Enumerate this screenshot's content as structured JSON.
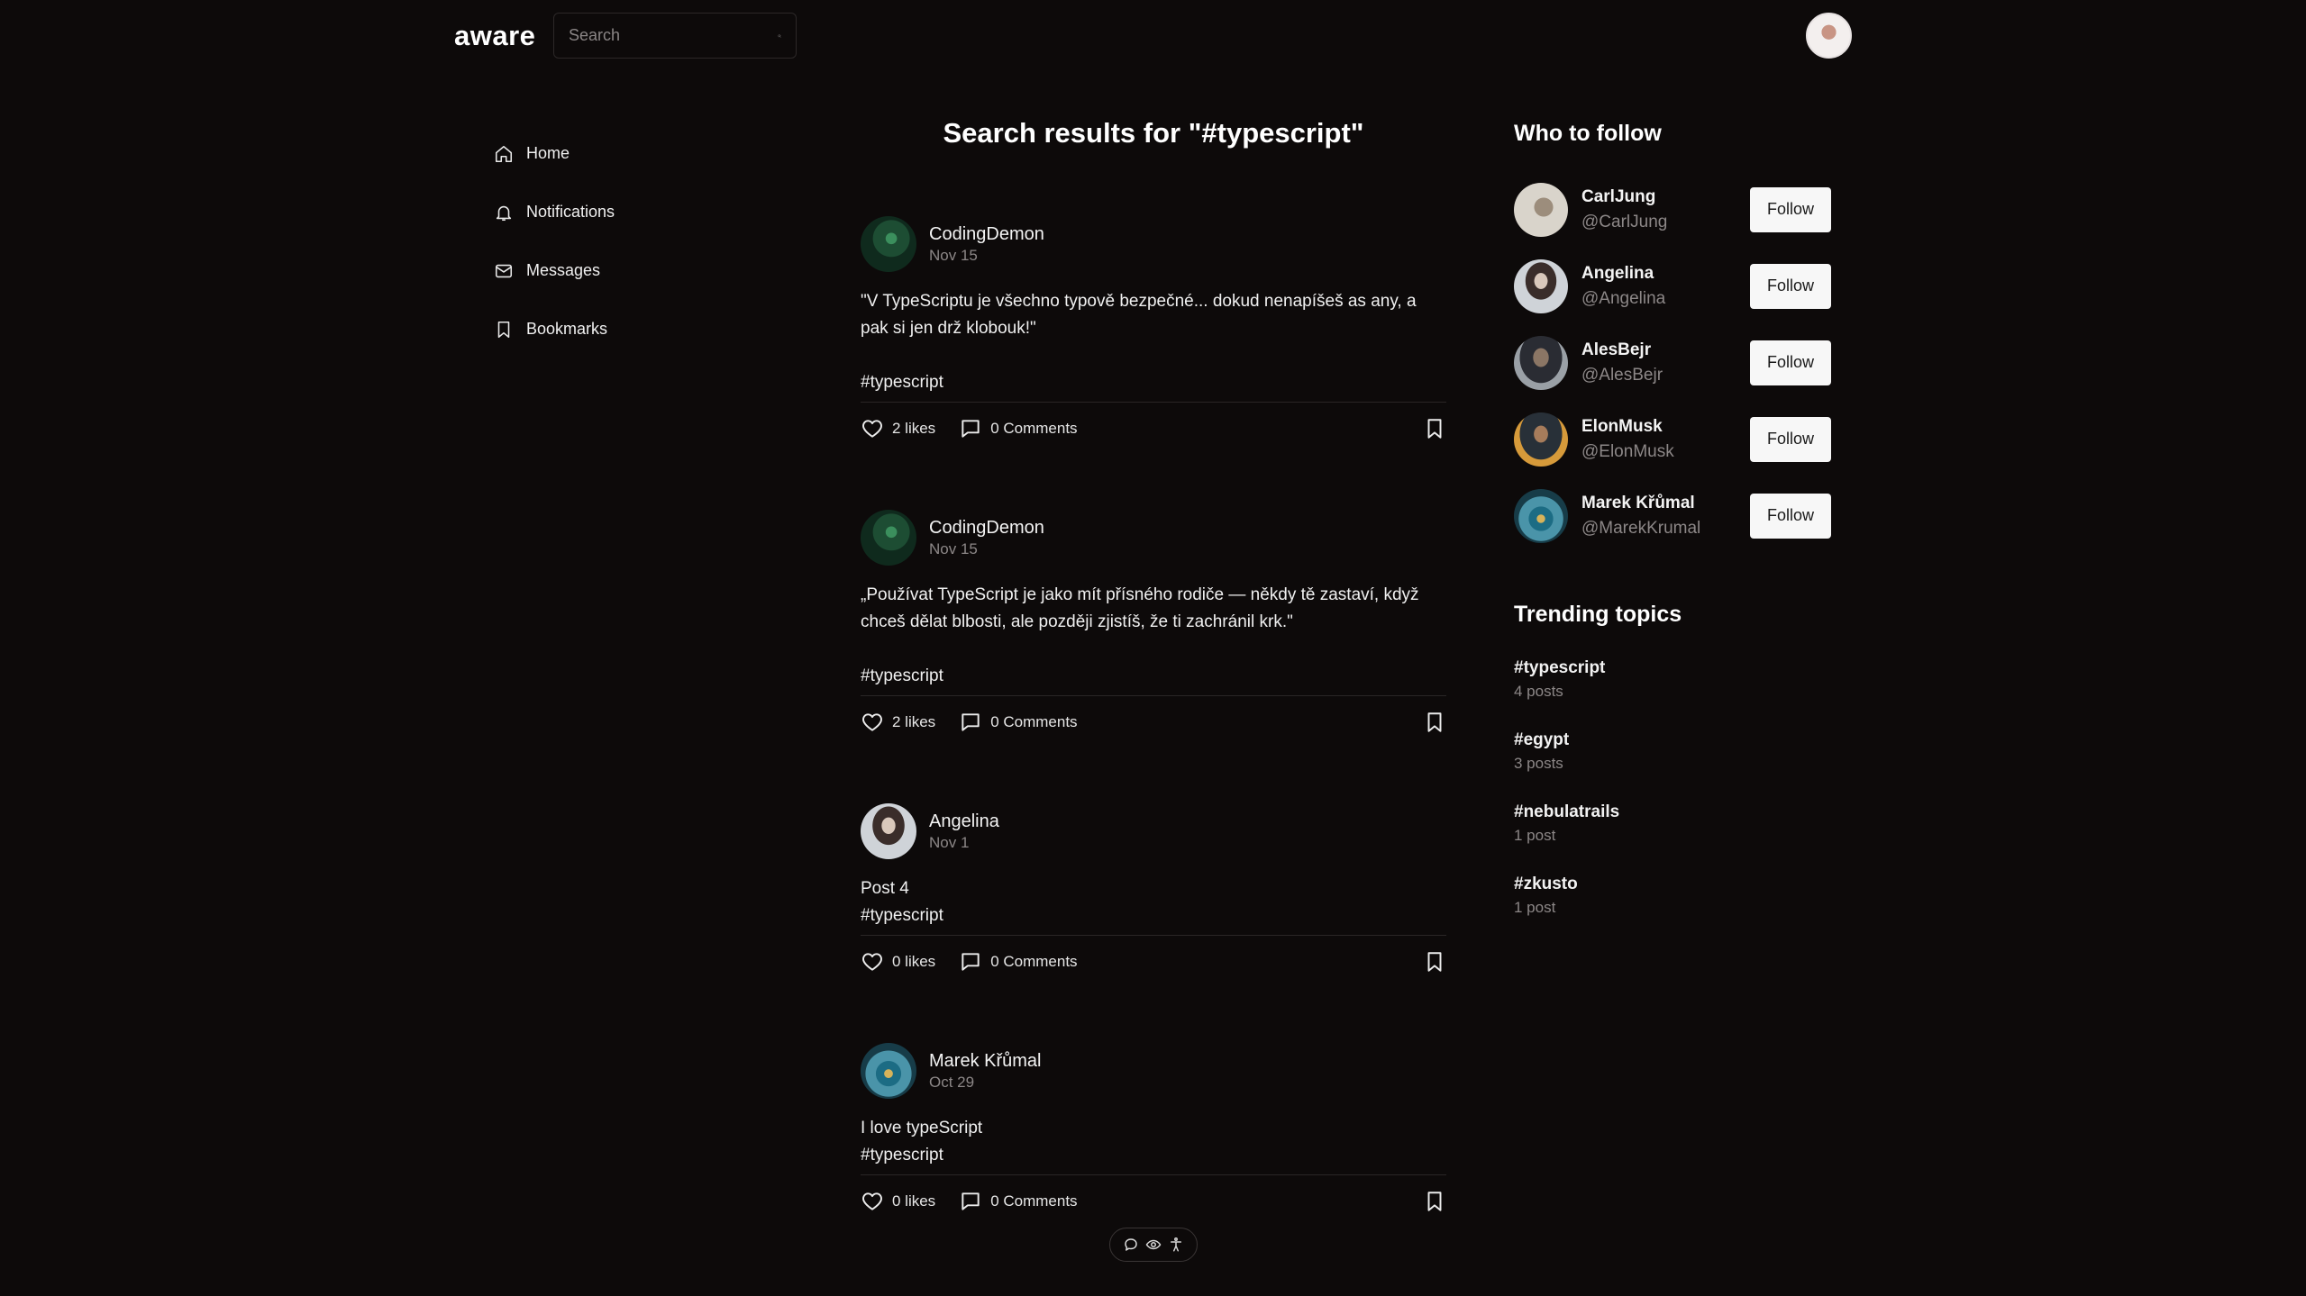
{
  "header": {
    "logo": "aware",
    "search_placeholder": "Search"
  },
  "nav": {
    "items": [
      {
        "label": "Home",
        "icon": "home-icon"
      },
      {
        "label": "Notifications",
        "icon": "bell-icon"
      },
      {
        "label": "Messages",
        "icon": "mail-icon"
      },
      {
        "label": "Bookmarks",
        "icon": "bookmark-icon"
      }
    ]
  },
  "main": {
    "title": "Search results for \"#typescript\"",
    "posts": [
      {
        "author": "CodingDemon",
        "date": "Nov 15",
        "text": "\"V TypeScriptu je všechno typově bezpečné... dokud nenapíšeš as any, a pak si jen drž klobouk!\"",
        "tag": "#typescript",
        "likes": "2 likes",
        "comments": "0 Comments"
      },
      {
        "author": "CodingDemon",
        "date": "Nov 15",
        "text": "„Používat TypeScript je jako mít přísného rodiče — někdy tě zastaví, když chceš dělat blbosti, ale později zjistíš, že ti zachránil krk.\"",
        "tag": "#typescript",
        "likes": "2 likes",
        "comments": "0 Comments"
      },
      {
        "author": "Angelina",
        "date": "Nov 1",
        "text": "Post 4",
        "tag": "#typescript",
        "likes": "0 likes",
        "comments": "0 Comments"
      },
      {
        "author": "Marek Křůmal",
        "date": "Oct 29",
        "text": "I love typeScript",
        "tag": "#typescript",
        "likes": "0 likes",
        "comments": "0 Comments"
      }
    ]
  },
  "who_to_follow": {
    "title": "Who to follow",
    "button_label": "Follow",
    "users": [
      {
        "name": "CarlJung",
        "handle": "@CarlJung"
      },
      {
        "name": "Angelina",
        "handle": "@Angelina"
      },
      {
        "name": "AlesBejr",
        "handle": "@AlesBejr"
      },
      {
        "name": "ElonMusk",
        "handle": "@ElonMusk"
      },
      {
        "name": "Marek Křůmal",
        "handle": "@MarekKrumal"
      }
    ]
  },
  "trending": {
    "title": "Trending topics",
    "topics": [
      {
        "tag": "#typescript",
        "count": "4 posts"
      },
      {
        "tag": "#egypt",
        "count": "3 posts"
      },
      {
        "tag": "#nebulatrails",
        "count": "1 post"
      },
      {
        "tag": "#zkusto",
        "count": "1 post"
      }
    ]
  },
  "colors": {
    "background": "#0d0a0a",
    "text": "#f2f2f2",
    "muted": "#8c8787",
    "button_bg": "#f7f7f7"
  }
}
